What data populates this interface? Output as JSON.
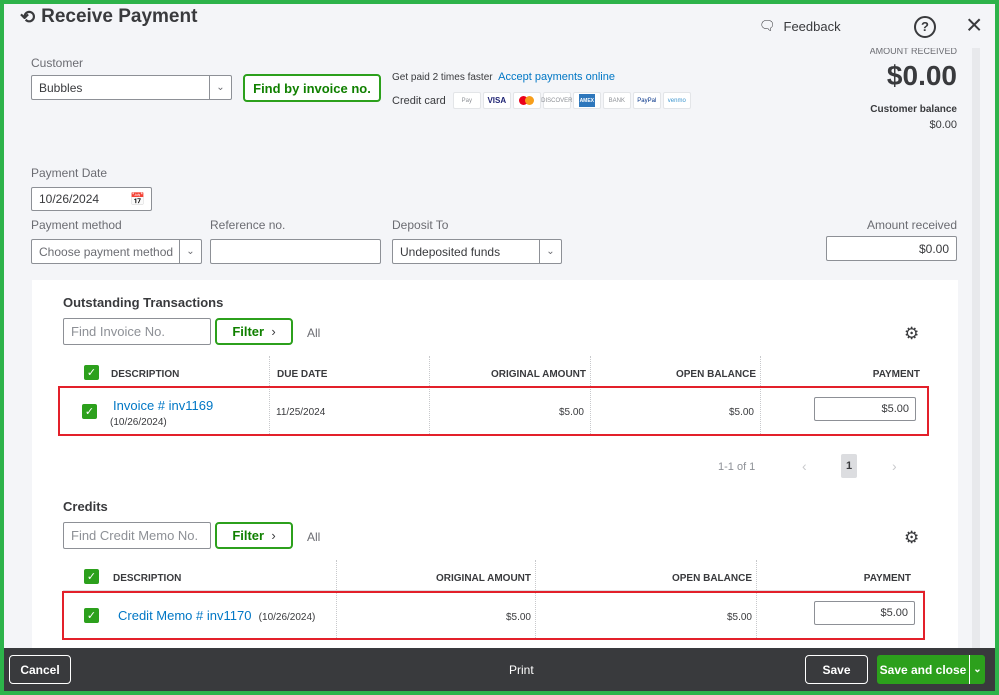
{
  "header": {
    "title": "Receive Payment",
    "feedback": "Feedback",
    "help_icon": "?",
    "close_icon": "×"
  },
  "customer": {
    "label": "Customer",
    "value": "Bubbles",
    "find_invoice": "Find by invoice no."
  },
  "promo": {
    "text": "Get paid 2 times faster",
    "link": "Accept payments online",
    "credit_card_label": "Credit card",
    "cards": [
      "Pay",
      "VISA",
      "",
      "DISCOVER",
      "AMEX",
      "BANK",
      "PayPal",
      "venmo"
    ]
  },
  "amount_summary": {
    "label": "AMOUNT RECEIVED",
    "value": "$0.00",
    "balance_label": "Customer balance",
    "balance_value": "$0.00"
  },
  "payment_date": {
    "label": "Payment Date",
    "value": "10/26/2024"
  },
  "payment_method": {
    "label": "Payment method",
    "placeholder": "Choose payment method"
  },
  "reference": {
    "label": "Reference no.",
    "value": ""
  },
  "deposit_to": {
    "label": "Deposit To",
    "value": "Undeposited funds"
  },
  "amount_received": {
    "label": "Amount received",
    "value": "$0.00"
  },
  "outstanding": {
    "title": "Outstanding Transactions",
    "search_placeholder": "Find Invoice No.",
    "filter": "Filter",
    "all": "All",
    "columns": [
      "DESCRIPTION",
      "DUE DATE",
      "ORIGINAL AMOUNT",
      "OPEN BALANCE",
      "PAYMENT"
    ],
    "rows": [
      {
        "description": "Invoice # inv1169",
        "date": "(10/26/2024)",
        "due_date": "11/25/2024",
        "original": "$5.00",
        "open_balance": "$5.00",
        "payment": "$5.00",
        "checked": true
      }
    ],
    "pagination": {
      "range": "1-1 of 1",
      "prev": "‹",
      "page": "1",
      "next": "›"
    }
  },
  "credits": {
    "title": "Credits",
    "search_placeholder": "Find Credit Memo No.",
    "filter": "Filter",
    "all": "All",
    "columns": [
      "DESCRIPTION",
      "ORIGINAL AMOUNT",
      "OPEN BALANCE",
      "PAYMENT"
    ],
    "rows": [
      {
        "description": "Credit Memo # inv1170",
        "date": "(10/26/2024)",
        "original": "$5.00",
        "open_balance": "$5.00",
        "payment": "$5.00",
        "checked": true
      }
    ]
  },
  "footer": {
    "cancel": "Cancel",
    "print": "Print",
    "save": "Save",
    "save_close": "Save and close"
  },
  "colors": {
    "accent": "#2ca01c",
    "highlight": "#e3202a",
    "footer": "#393a3d",
    "link": "#0077c5"
  }
}
